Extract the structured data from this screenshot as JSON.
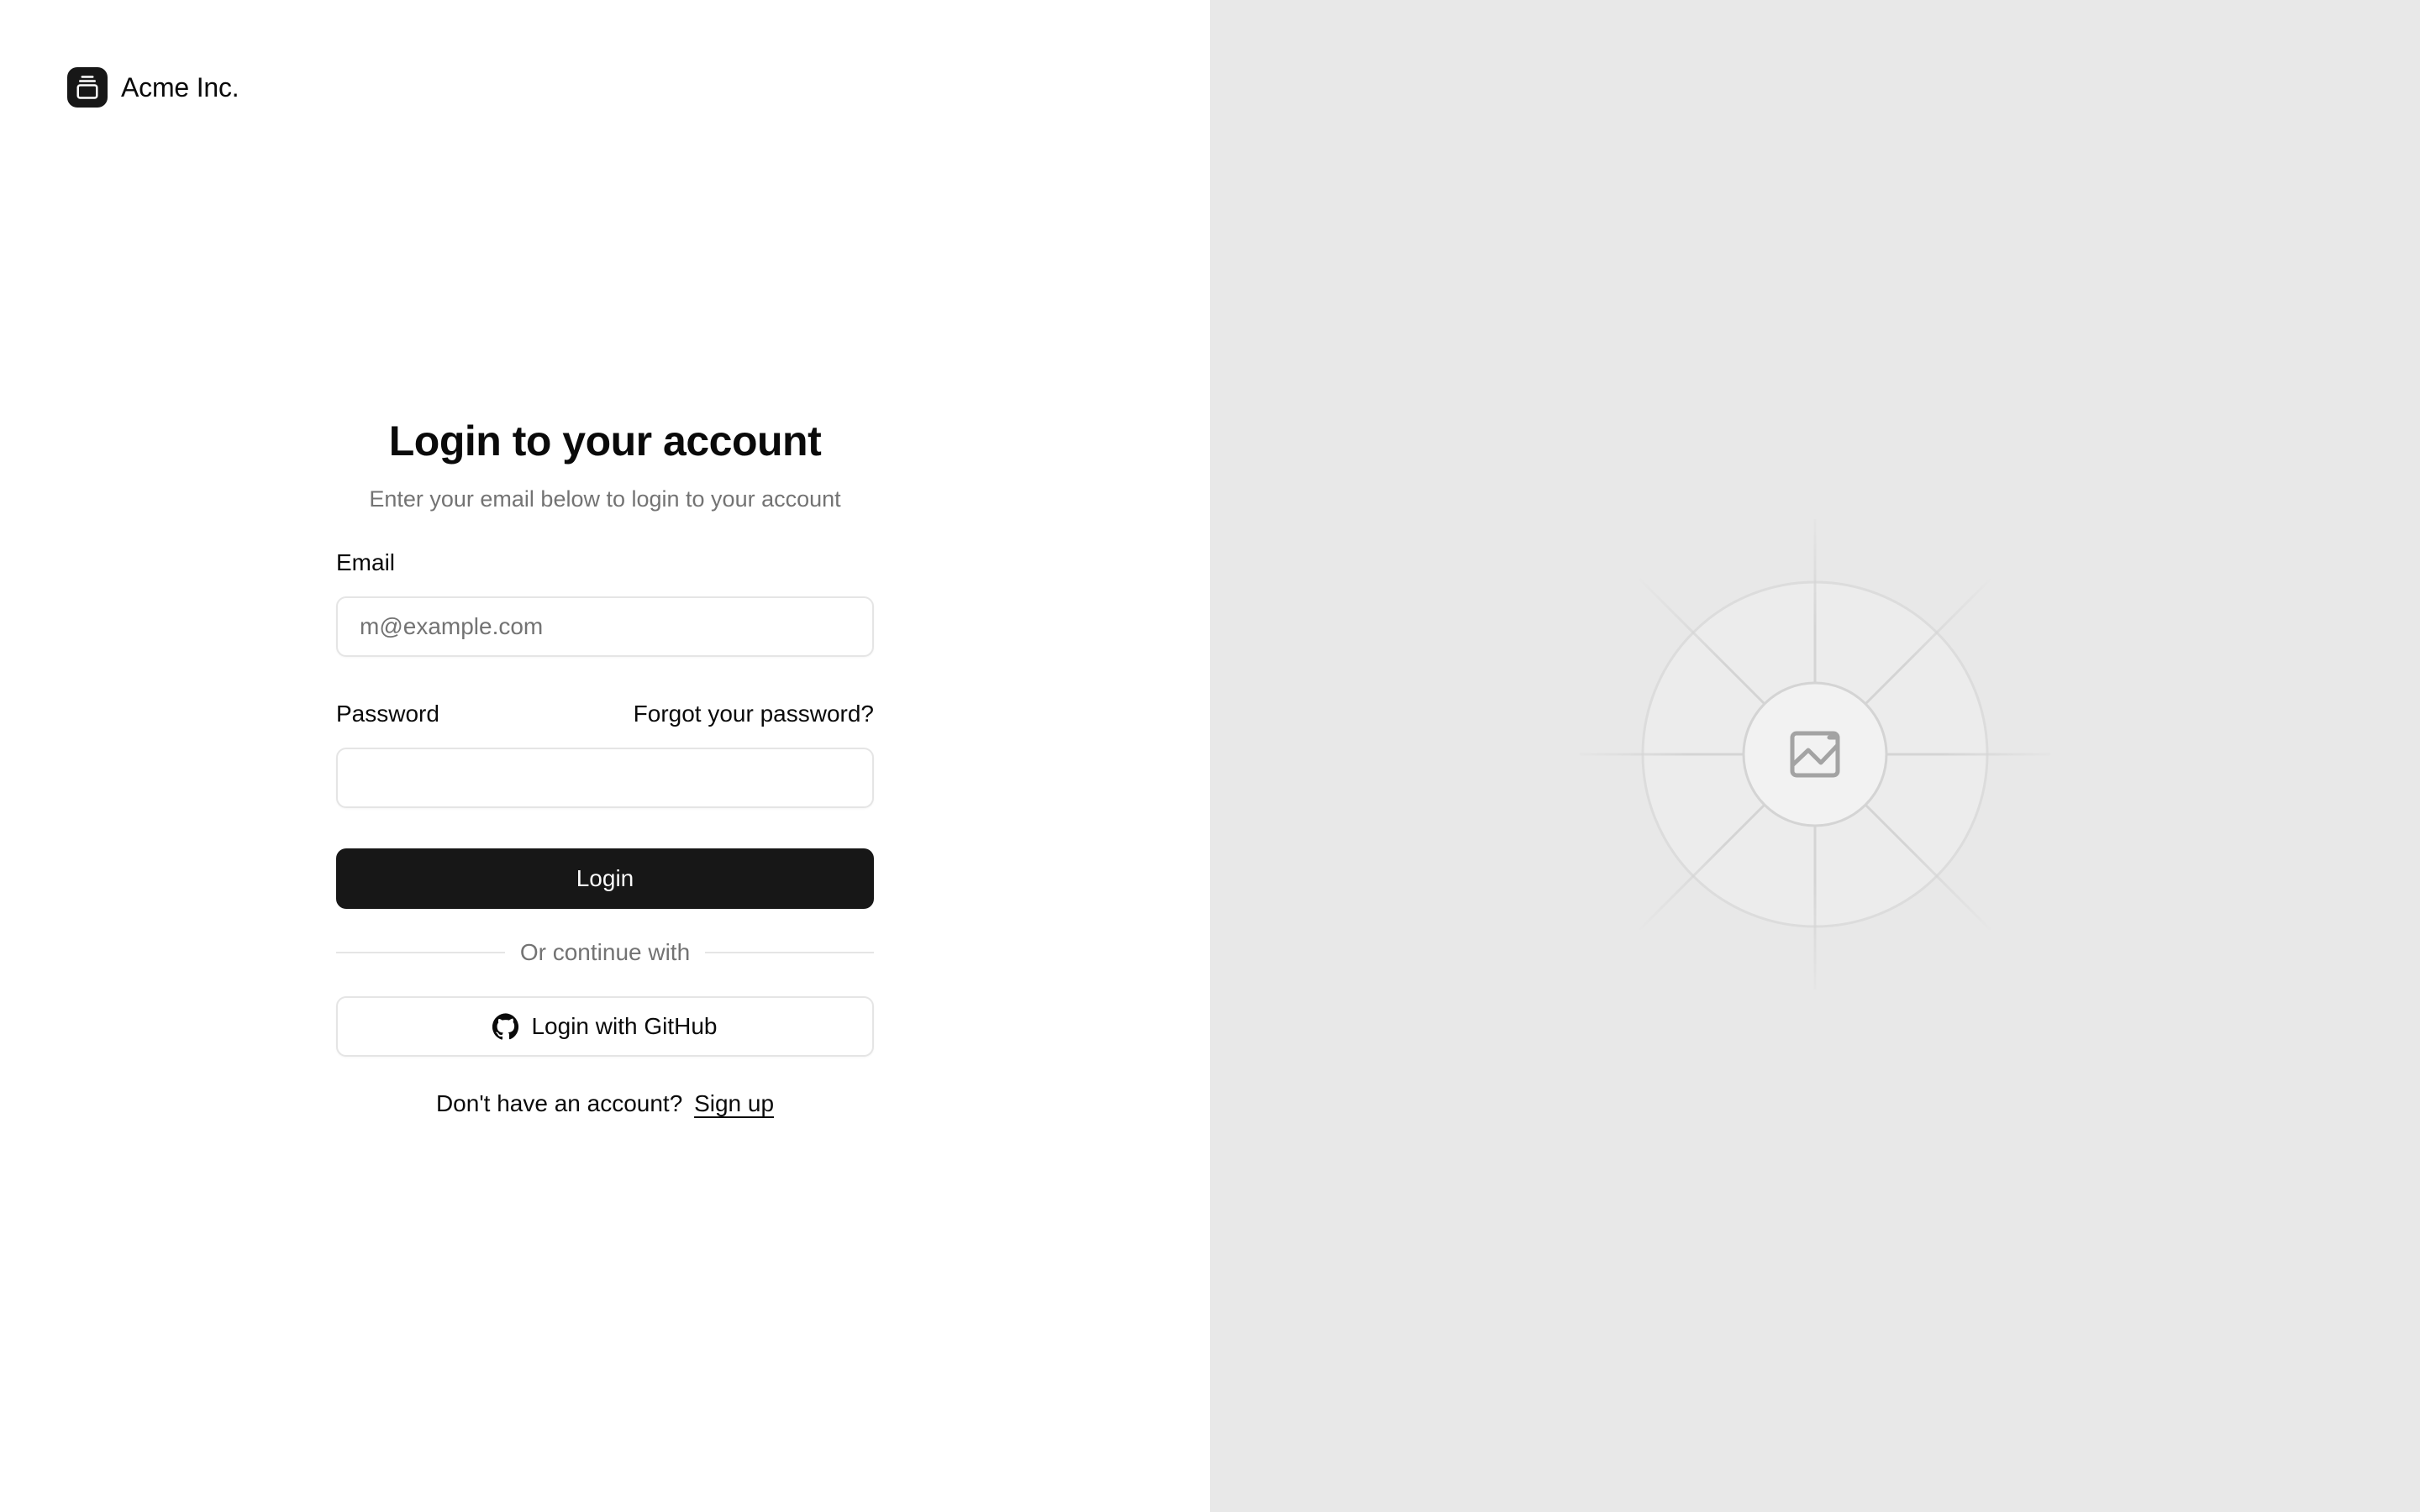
{
  "brand": {
    "name": "Acme Inc.",
    "logo_icon": "gallery-vertical-end-icon"
  },
  "login_form": {
    "title": "Login to your account",
    "subtitle": "Enter your email below to login to your account",
    "email": {
      "label": "Email",
      "placeholder": "m@example.com",
      "value": ""
    },
    "password": {
      "label": "Password",
      "value": "",
      "forgot_link": "Forgot your password?"
    },
    "login_button": "Login",
    "divider_text": "Or continue with",
    "github_button": "Login with GitHub",
    "github_icon": "github-icon",
    "signup_prompt": "Don't have an account?",
    "signup_link": "Sign up"
  },
  "side_panel": {
    "image_icon": "image-placeholder-icon"
  },
  "colors": {
    "primary": "#171717",
    "muted_text": "#737373",
    "border": "#e5e5e5",
    "side_panel_bg": "#e8e8e8"
  }
}
